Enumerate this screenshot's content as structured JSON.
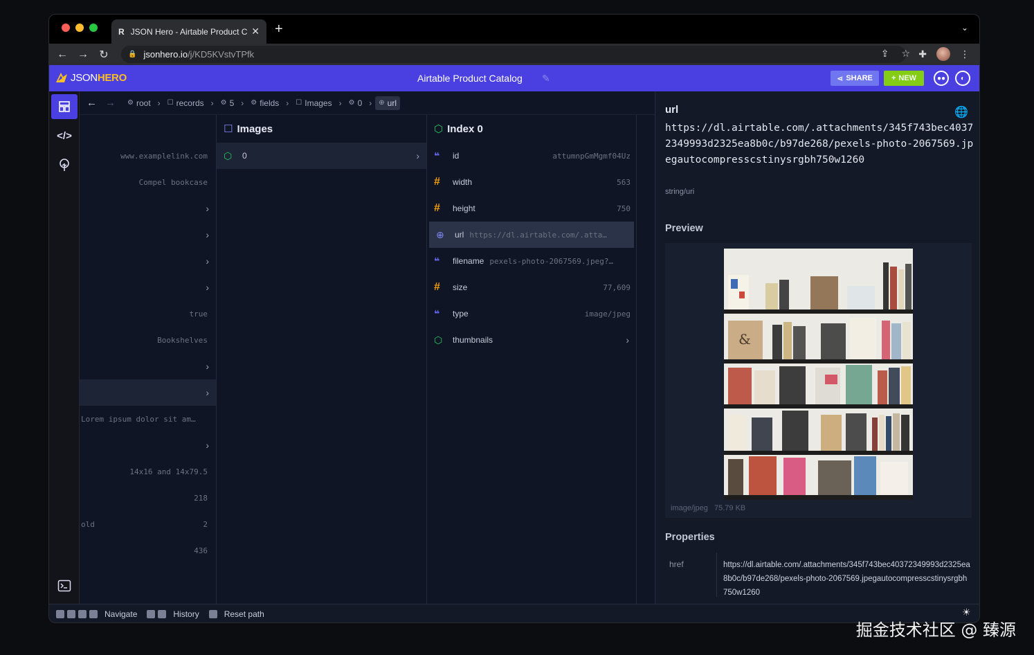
{
  "browser": {
    "tab_title": "JSON Hero - Airtable Product Catalog",
    "tab_favicon": "R",
    "url_host": "jsonhero.io",
    "url_path": "/j/KD5KVstvTPfk"
  },
  "app": {
    "logo_json": "JSON",
    "logo_hero": "HERO",
    "doc_title": "Airtable Product Catalog",
    "share_label": "SHARE",
    "new_label": "NEW",
    "accent": "#4a3fe0"
  },
  "breadcrumb": [
    {
      "label": "root",
      "icon": "object-icon"
    },
    {
      "label": "records",
      "icon": "array-icon"
    },
    {
      "label": "5",
      "icon": "object-icon"
    },
    {
      "label": "fields",
      "icon": "object-icon"
    },
    {
      "label": "Images",
      "icon": "array-icon"
    },
    {
      "label": "0",
      "icon": "object-icon"
    },
    {
      "label": "url",
      "icon": "globe-icon"
    }
  ],
  "col1": {
    "rows": [
      {
        "key": "",
        "value": "www.examplelink.com"
      },
      {
        "key": "",
        "value": "Compel bookcase"
      },
      {
        "key": "",
        "value": ">"
      },
      {
        "key": "",
        "value": ">"
      },
      {
        "key": "",
        "value": ">"
      },
      {
        "key": "",
        "value": ">"
      },
      {
        "key": "",
        "value": "true"
      },
      {
        "key": "",
        "value": "Bookshelves"
      },
      {
        "key": "",
        "value": ">"
      },
      {
        "key": "",
        "value": ">"
      },
      {
        "key": "Lorem ipsum dolor sit am…",
        "value": ""
      },
      {
        "key": "",
        "value": ">"
      },
      {
        "key": "",
        "value": "14x16 and 14x79.5"
      },
      {
        "key": "",
        "value": "218"
      },
      {
        "key": "old",
        "value": "2"
      },
      {
        "key": "",
        "value": "436"
      }
    ]
  },
  "col2": {
    "title": "Images",
    "rows": [
      {
        "key": "0"
      }
    ]
  },
  "col3": {
    "title": "Index 0",
    "rows": [
      {
        "type": "string",
        "key": "id",
        "value": "attumnpGmMgmf04Uz"
      },
      {
        "type": "number",
        "key": "width",
        "value": "563"
      },
      {
        "type": "number",
        "key": "height",
        "value": "750"
      },
      {
        "type": "url",
        "key": "url",
        "value": "https://dl.airtable.com/.attach…"
      },
      {
        "type": "string",
        "key": "filename",
        "value": "pexels-photo-2067569.jpeg?…"
      },
      {
        "type": "number",
        "key": "size",
        "value": "77,609"
      },
      {
        "type": "string",
        "key": "type",
        "value": "image/jpeg"
      },
      {
        "type": "object",
        "key": "thumbnails",
        "value": ""
      }
    ]
  },
  "side": {
    "title": "url",
    "value": "https://dl.airtable.com/.attachments/345f743bec40372349993d2325ea8b0c/b97de268/pexels-photo-2067569.jpegautocompresscstinysrgbh750w1260",
    "value_type": "string/uri",
    "preview_heading": "Preview",
    "preview_meta_type": "image/jpeg",
    "preview_meta_size": "75.79 KB",
    "properties_heading": "Properties",
    "prop_key": "href",
    "prop_value": "https://dl.airtable.com/.attachments/345f743bec40372349993d2325ea8b0c/b97de268/pexels-photo-2067569.jpegautocompresscstinysrgbh750w1260"
  },
  "footer": {
    "navigate": "Navigate",
    "history": "History",
    "reset": "Reset path"
  },
  "watermark": "掘金技术社区 @ 臻源"
}
